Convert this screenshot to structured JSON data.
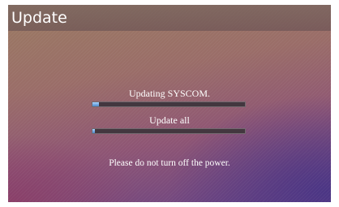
{
  "window": {
    "title": "Update"
  },
  "progress": {
    "current_task_label": "Updating SYSCOM.",
    "current_task_fraction": 0.04,
    "overall_label": "Update all",
    "overall_fraction": 0.01
  },
  "notice": "Please do not turn off the power.",
  "colors": {
    "bar_fill": "#6aa6e8",
    "bar_track": "#43373f",
    "text": "#ffffff"
  }
}
